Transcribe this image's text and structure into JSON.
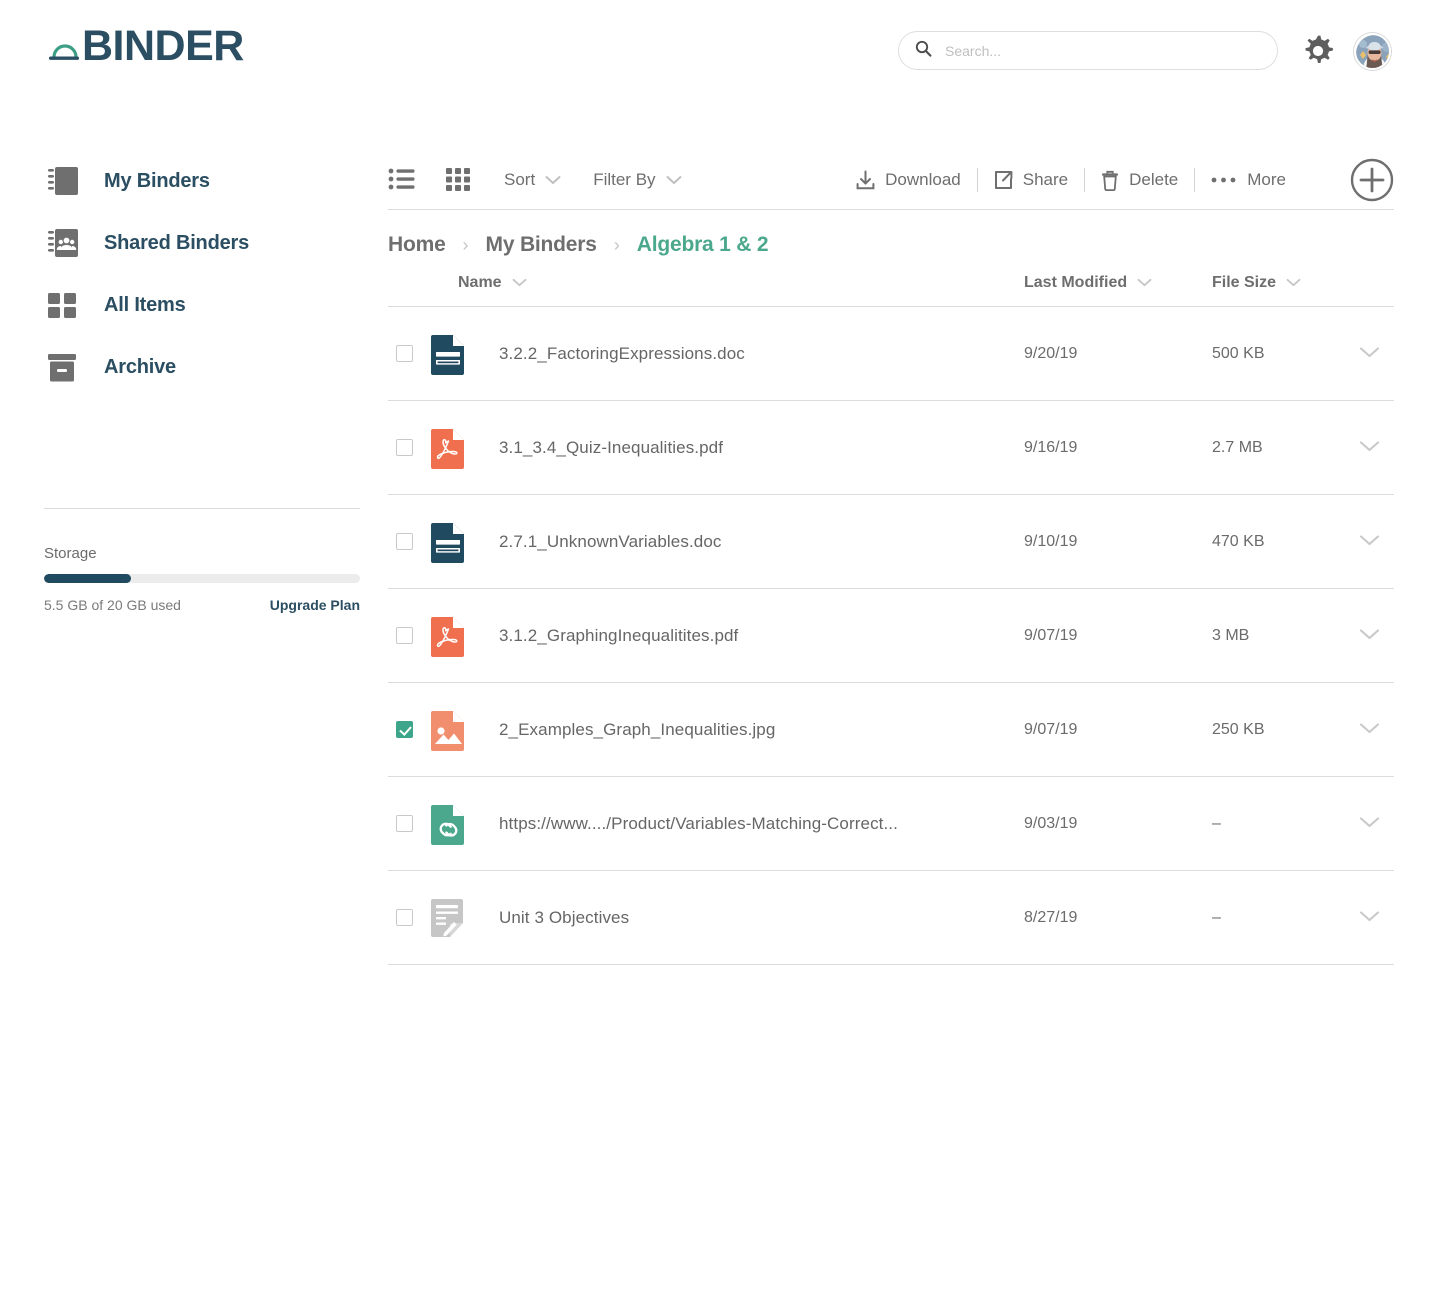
{
  "brand": {
    "name": "BINDER",
    "logo_icon": "binder-arc-logo",
    "navy": "#2b4e62",
    "green": "#4ca88c"
  },
  "header": {
    "search": {
      "placeholder": "Search...",
      "value": "",
      "icon": "search-icon"
    },
    "settings_icon": "gear-icon",
    "avatar_icon": "user-avatar"
  },
  "sidebar": {
    "items": [
      {
        "label": "My Binders",
        "icon": "binder-icon"
      },
      {
        "label": "Shared Binders",
        "icon": "shared-binder-icon"
      },
      {
        "label": "All Items",
        "icon": "grid-squares-icon"
      },
      {
        "label": "Archive",
        "icon": "archive-box-icon"
      }
    ],
    "storage": {
      "title": "Storage",
      "used_label": "5.5 GB of 20 GB used",
      "upgrade_label": "Upgrade Plan",
      "percent": 27.5,
      "bar_color": "#1f4a5f"
    }
  },
  "toolbar": {
    "view_list_icon": "list-view-icon",
    "view_grid_icon": "grid-view-icon",
    "sort_label": "Sort",
    "filter_label": "Filter By",
    "actions": [
      {
        "label": "Download",
        "icon": "download-icon"
      },
      {
        "label": "Share",
        "icon": "share-icon"
      },
      {
        "label": "Delete",
        "icon": "trash-icon"
      },
      {
        "label": "More",
        "icon": "ellipsis-icon"
      }
    ],
    "add_icon": "plus-circle-icon"
  },
  "breadcrumb": {
    "items": [
      {
        "label": "Home",
        "current": false
      },
      {
        "label": "My Binders",
        "current": false
      },
      {
        "label": "Algebra 1 & 2",
        "current": true
      }
    ],
    "separator": "›"
  },
  "table": {
    "columns": [
      {
        "label": "Name",
        "sortable": true
      },
      {
        "label": "Last Modified",
        "sortable": true
      },
      {
        "label": "File Size",
        "sortable": true
      }
    ],
    "rows": [
      {
        "name": "3.2.2_FactoringExpressions.doc",
        "modified": "9/20/19",
        "size": "500 KB",
        "icon": "doc-file-icon",
        "type": "doc",
        "selected": false
      },
      {
        "name": "3.1_3.4_Quiz-Inequalities.pdf",
        "modified": "9/16/19",
        "size": "2.7 MB",
        "icon": "pdf-file-icon",
        "type": "pdf",
        "selected": false
      },
      {
        "name": "2.7.1_UnknownVariables.doc",
        "modified": "9/10/19",
        "size": "470 KB",
        "icon": "doc-file-icon",
        "type": "doc",
        "selected": false
      },
      {
        "name": "3.1.2_GraphingInequalitites.pdf",
        "modified": "9/07/19",
        "size": "3 MB",
        "icon": "pdf-file-icon",
        "type": "pdf",
        "selected": false
      },
      {
        "name": "2_Examples_Graph_Inequalities.jpg",
        "modified": "9/07/19",
        "size": "250 KB",
        "icon": "image-file-icon",
        "type": "jpg",
        "selected": true
      },
      {
        "name": "https://www..../Product/Variables-Matching-Correct...",
        "modified": "9/03/19",
        "size": "–",
        "icon": "link-file-icon",
        "type": "link",
        "selected": false
      },
      {
        "name": "Unit 3 Objectives",
        "modified": "8/27/19",
        "size": "–",
        "icon": "note-file-icon",
        "type": "note",
        "selected": false
      }
    ]
  }
}
